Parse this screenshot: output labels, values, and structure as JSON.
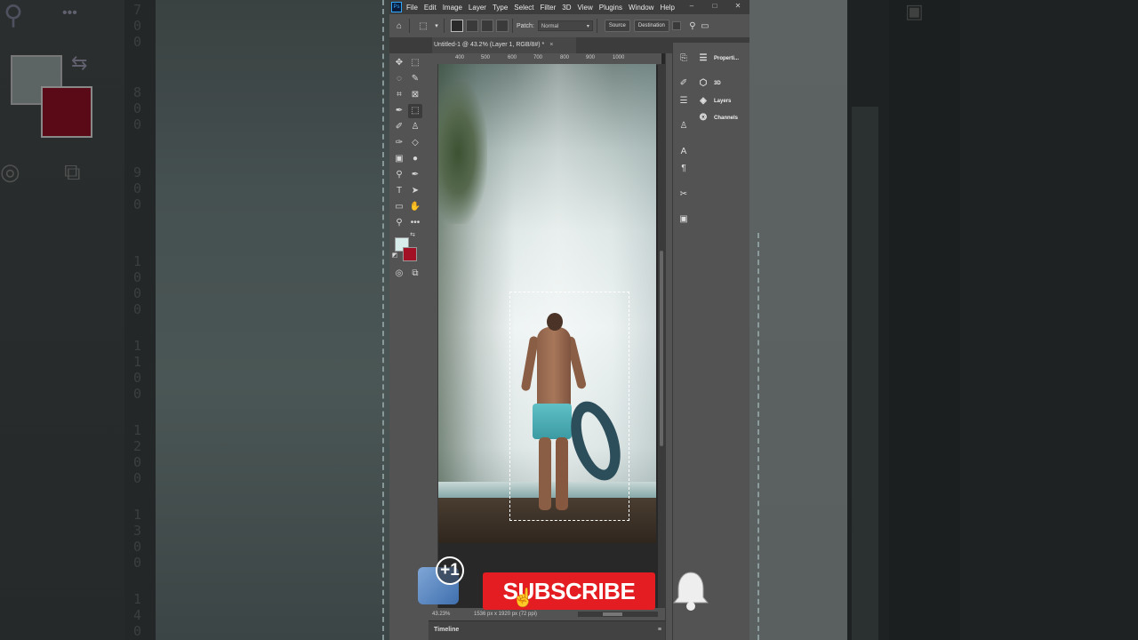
{
  "menubar": {
    "items": [
      "File",
      "Edit",
      "Image",
      "Layer",
      "Type",
      "Select",
      "Filter",
      "3D",
      "View",
      "Plugins",
      "Window",
      "Help"
    ],
    "window_controls": [
      "–",
      "□",
      "✕"
    ]
  },
  "options": {
    "patch_label": "Patch:",
    "patch_mode": "Normal",
    "source_label": "Source",
    "destination_label": "Destination"
  },
  "document": {
    "tab_title": "Untitled-1 @ 43.2% (Layer 1, RGB/8#) *",
    "close": "×"
  },
  "ruler": {
    "ticks": [
      "400",
      "500",
      "600",
      "700",
      "800",
      "900",
      "1000"
    ]
  },
  "status": {
    "zoom": "43.23%",
    "dimensions": "1536 px x 1920 px (72 ppi)"
  },
  "timeline": {
    "label": "Timeline",
    "menu": "≡"
  },
  "panels": {
    "properties": "Properti...",
    "three_d": "3D",
    "layers": "Layers",
    "channels": "Channels"
  },
  "colors": {
    "foreground": "#d9ecec",
    "background": "#a11024",
    "accent": "#31a8ff"
  },
  "overlay": {
    "like_badge": "+1",
    "subscribe_label": "SUBSCRIBE"
  },
  "bg_ruler_digits": [
    "7 0 0",
    "8 0 0",
    "9 0 0",
    "1 0 0 0",
    "1 1 0 0",
    "1 2 0 0",
    "1 3 0 0",
    "1 4 0"
  ]
}
